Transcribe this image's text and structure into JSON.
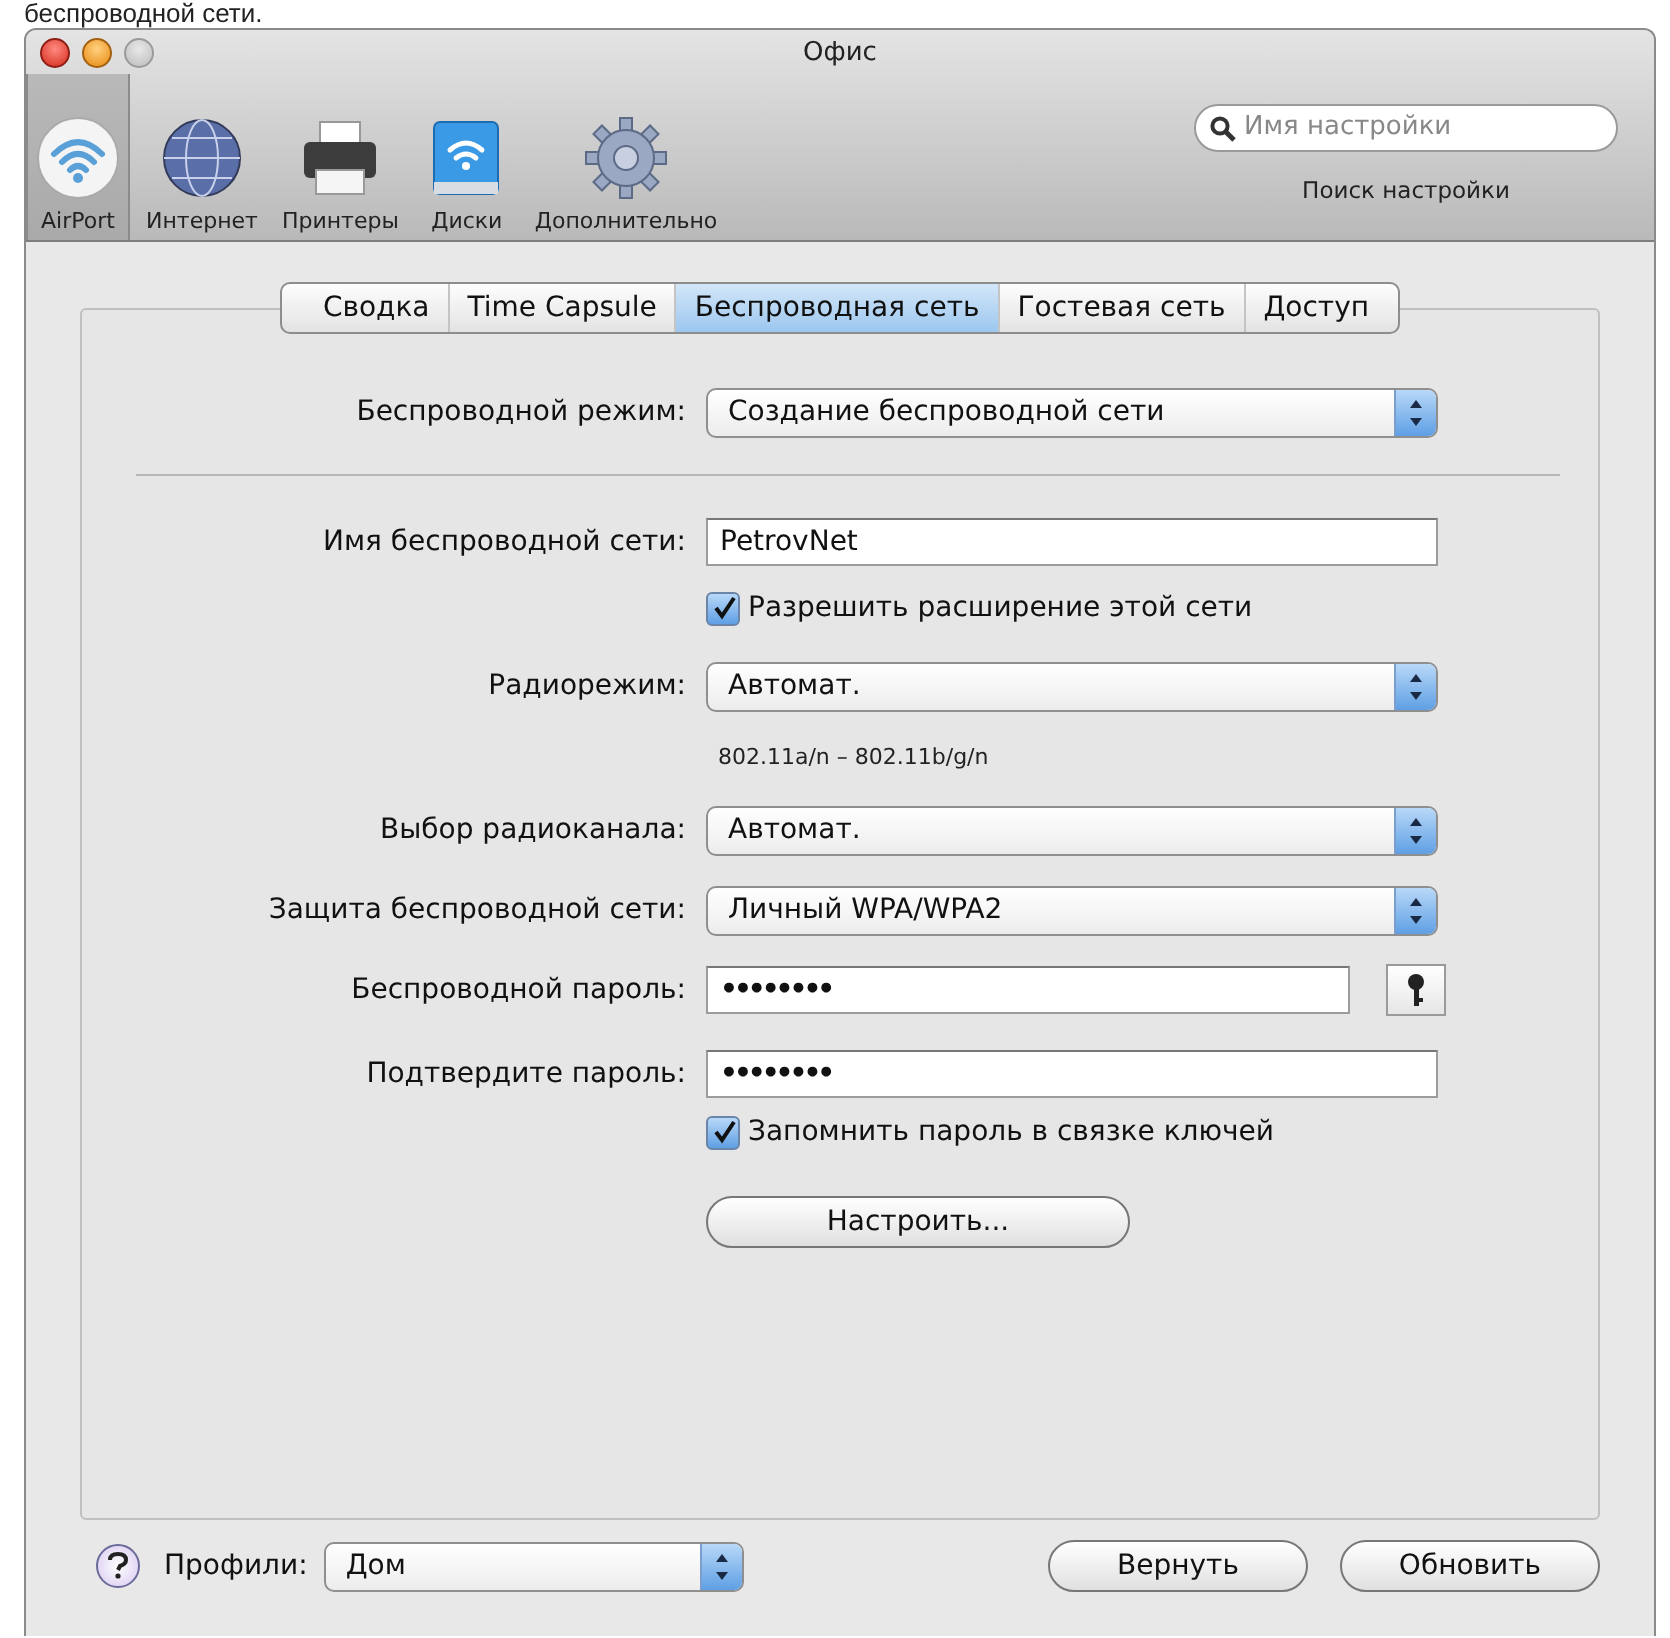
{
  "caption": "беспроводной сети.",
  "window": {
    "title": "Офис"
  },
  "toolbar": {
    "items": [
      {
        "label": "AirPort",
        "kind": "airport",
        "selected": true
      },
      {
        "label": "Интернет",
        "kind": "internet",
        "selected": false
      },
      {
        "label": "Принтеры",
        "kind": "printers",
        "selected": false
      },
      {
        "label": "Диски",
        "kind": "disks",
        "selected": false
      },
      {
        "label": "Дополнительно",
        "kind": "advanced",
        "selected": false
      }
    ],
    "search": {
      "placeholder": "Имя настройки",
      "label": "Поиск настройки"
    }
  },
  "tabs": [
    {
      "label": "Сводка",
      "selected": false
    },
    {
      "label": "Time Capsule",
      "selected": false
    },
    {
      "label": "Беспроводная сеть",
      "selected": true
    },
    {
      "label": "Гостевая сеть",
      "selected": false
    },
    {
      "label": "Доступ",
      "selected": false
    }
  ],
  "form": {
    "rows": [
      {
        "kind": "popup",
        "label": "Беспроводной режим:",
        "value": "Создание беспроводной сети"
      },
      {
        "kind": "divider"
      },
      {
        "kind": "text",
        "label": "Имя беспроводной сети:",
        "value": "PetrovNet"
      },
      {
        "kind": "checkbox",
        "text": "Разрешить расширение этой сети",
        "checked": true
      },
      {
        "kind": "popup",
        "label": "Радиорежим:",
        "value": "Автомат."
      },
      {
        "kind": "note",
        "text": "802.11a/n – 802.11b/g/n"
      },
      {
        "kind": "popup",
        "label": "Выбор радиоканала:",
        "value": "Автомат."
      },
      {
        "kind": "popup",
        "label": "Защита беспроводной сети:",
        "value": "Личный WPA/WPA2"
      },
      {
        "kind": "password",
        "label": "Беспроводной пароль:",
        "value": "••••••••",
        "key_button": true
      },
      {
        "kind": "password",
        "label": "Подтвердите пароль:",
        "value": "••••••••"
      },
      {
        "kind": "checkbox",
        "text": "Запомнить пароль в связке ключей",
        "checked": true
      },
      {
        "kind": "button",
        "text": "Настроить..."
      }
    ]
  },
  "footer": {
    "profiles_label": "Профили:",
    "profile": "Дом",
    "buttons": [
      "Вернуть",
      "Обновить"
    ]
  }
}
